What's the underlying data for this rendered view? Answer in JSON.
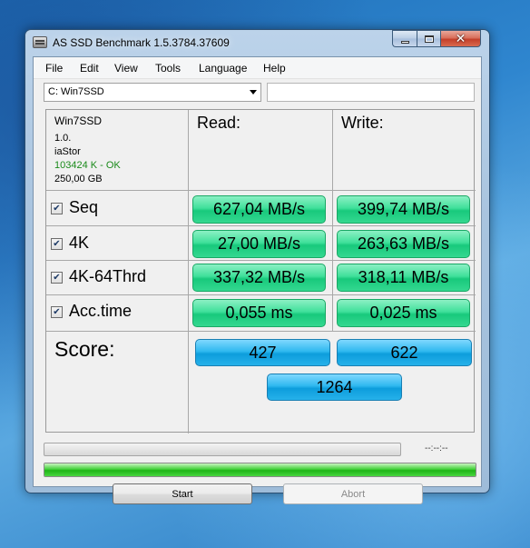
{
  "window": {
    "title": "AS SSD Benchmark 1.5.3784.37609"
  },
  "menu": [
    "File",
    "Edit",
    "View",
    "Tools",
    "Language",
    "Help"
  ],
  "drive_select": {
    "value": "C: Win7SSD"
  },
  "drive_info": {
    "name": "Win7SSD",
    "firmware": "1.0.",
    "driver": "iaStor",
    "alignment": "103424 K - OK",
    "size": "250,00 GB",
    "alignment_color": "#1a8a1a"
  },
  "headers": {
    "read": "Read:",
    "write": "Write:"
  },
  "tests": [
    {
      "label": "Seq",
      "checked": true,
      "read": "627,04 MB/s",
      "write": "399,74 MB/s"
    },
    {
      "label": "4K",
      "checked": true,
      "read": "27,00 MB/s",
      "write": "263,63 MB/s"
    },
    {
      "label": "4K-64Thrd",
      "checked": true,
      "read": "337,32 MB/s",
      "write": "318,11 MB/s"
    },
    {
      "label": "Acc.time",
      "checked": true,
      "read": "0,055 ms",
      "write": "0,025 ms"
    }
  ],
  "score": {
    "label": "Score:",
    "read": "427",
    "write": "622",
    "total": "1264"
  },
  "progress": {
    "elapsed": "--:--:--",
    "main_fraction": 1.0
  },
  "buttons": {
    "start": "Start",
    "abort": "Abort"
  },
  "colors": {
    "value_cell": "#3fe09a",
    "score_cell": "#2fb8ef",
    "progress_fill": "#1fb416"
  }
}
